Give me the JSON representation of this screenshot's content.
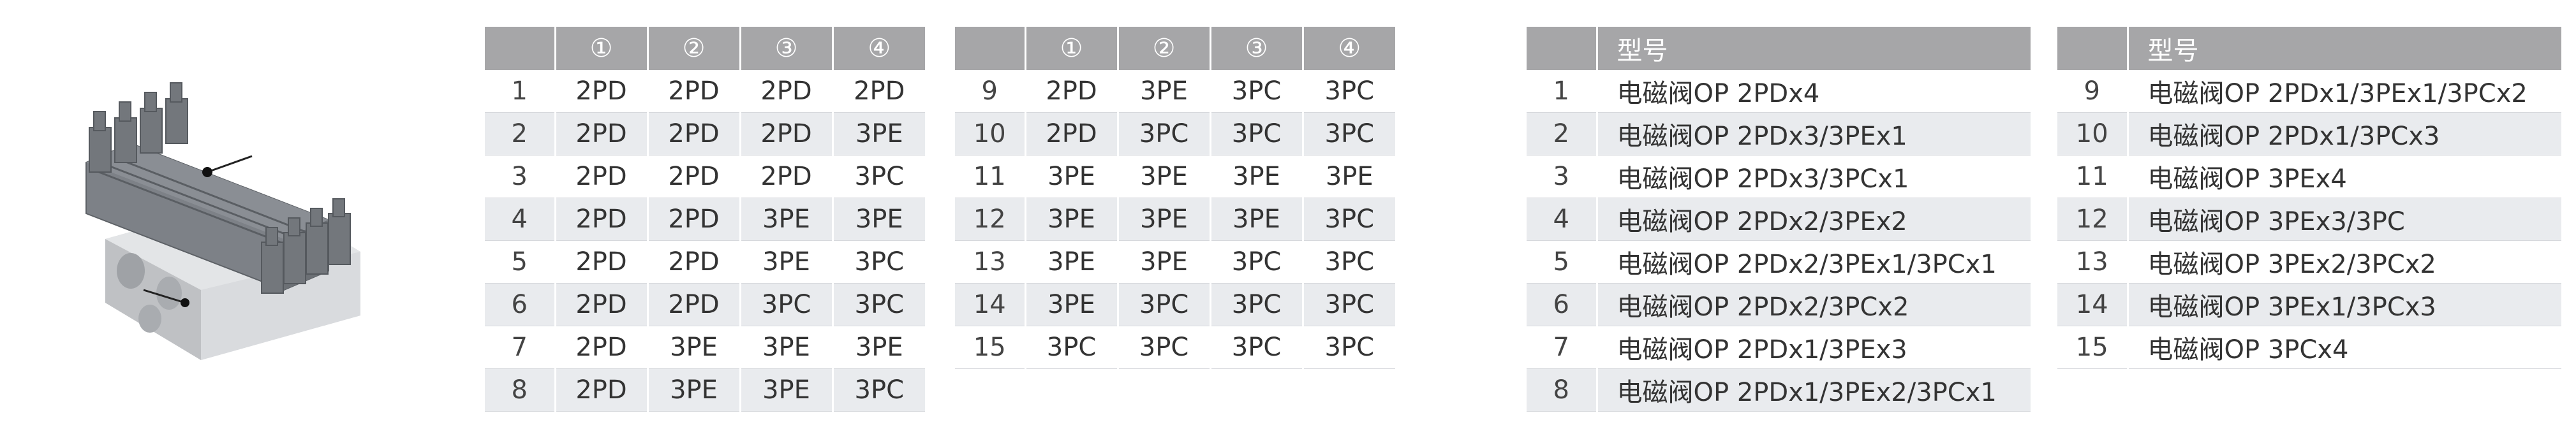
{
  "product_image": {
    "description_icon": "solenoid-valve-manifold-icon"
  },
  "config_table_left": {
    "headers": [
      "",
      "①",
      "②",
      "③",
      "④"
    ],
    "rows": [
      [
        "1",
        "2PD",
        "2PD",
        "2PD",
        "2PD"
      ],
      [
        "2",
        "2PD",
        "2PD",
        "2PD",
        "3PE"
      ],
      [
        "3",
        "2PD",
        "2PD",
        "2PD",
        "3PC"
      ],
      [
        "4",
        "2PD",
        "2PD",
        "3PE",
        "3PE"
      ],
      [
        "5",
        "2PD",
        "2PD",
        "3PE",
        "3PC"
      ],
      [
        "6",
        "2PD",
        "2PD",
        "3PC",
        "3PC"
      ],
      [
        "7",
        "2PD",
        "3PE",
        "3PE",
        "3PE"
      ],
      [
        "8",
        "2PD",
        "3PE",
        "3PE",
        "3PC"
      ]
    ]
  },
  "config_table_right": {
    "headers": [
      "",
      "①",
      "②",
      "③",
      "④"
    ],
    "rows": [
      [
        "9",
        "2PD",
        "3PE",
        "3PC",
        "3PC"
      ],
      [
        "10",
        "2PD",
        "3PC",
        "3PC",
        "3PC"
      ],
      [
        "11",
        "3PE",
        "3PE",
        "3PE",
        "3PE"
      ],
      [
        "12",
        "3PE",
        "3PE",
        "3PE",
        "3PC"
      ],
      [
        "13",
        "3PE",
        "3PE",
        "3PC",
        "3PC"
      ],
      [
        "14",
        "3PE",
        "3PC",
        "3PC",
        "3PC"
      ],
      [
        "15",
        "3PC",
        "3PC",
        "3PC",
        "3PC"
      ]
    ]
  },
  "model_table_left": {
    "headers": [
      "",
      "型号"
    ],
    "rows": [
      [
        "1",
        "电磁阀OP 2PDx4"
      ],
      [
        "2",
        "电磁阀OP 2PDx3/3PEx1"
      ],
      [
        "3",
        "电磁阀OP 2PDx3/3PCx1"
      ],
      [
        "4",
        "电磁阀OP 2PDx2/3PEx2"
      ],
      [
        "5",
        "电磁阀OP 2PDx2/3PEx1/3PCx1"
      ],
      [
        "6",
        "电磁阀OP 2PDx2/3PCx2"
      ],
      [
        "7",
        "电磁阀OP 2PDx1/3PEx3"
      ],
      [
        "8",
        "电磁阀OP 2PDx1/3PEx2/3PCx1"
      ]
    ]
  },
  "model_table_right": {
    "headers": [
      "",
      "型号"
    ],
    "rows": [
      [
        "9",
        "电磁阀OP 2PDx1/3PEx1/3PCx2"
      ],
      [
        "10",
        "电磁阀OP 2PDx1/3PCx3"
      ],
      [
        "11",
        "电磁阀OP 3PEx4"
      ],
      [
        "12",
        "电磁阀OP 3PEx3/3PC"
      ],
      [
        "13",
        "电磁阀OP 3PEx2/3PCx2"
      ],
      [
        "14",
        "电磁阀OP 3PEx1/3PCx3"
      ],
      [
        "15",
        "电磁阀OP 3PCx4"
      ]
    ]
  },
  "colors": {
    "header_bg": "#a6a6a8",
    "stripe": "#e9ebee",
    "text": "#333333"
  }
}
